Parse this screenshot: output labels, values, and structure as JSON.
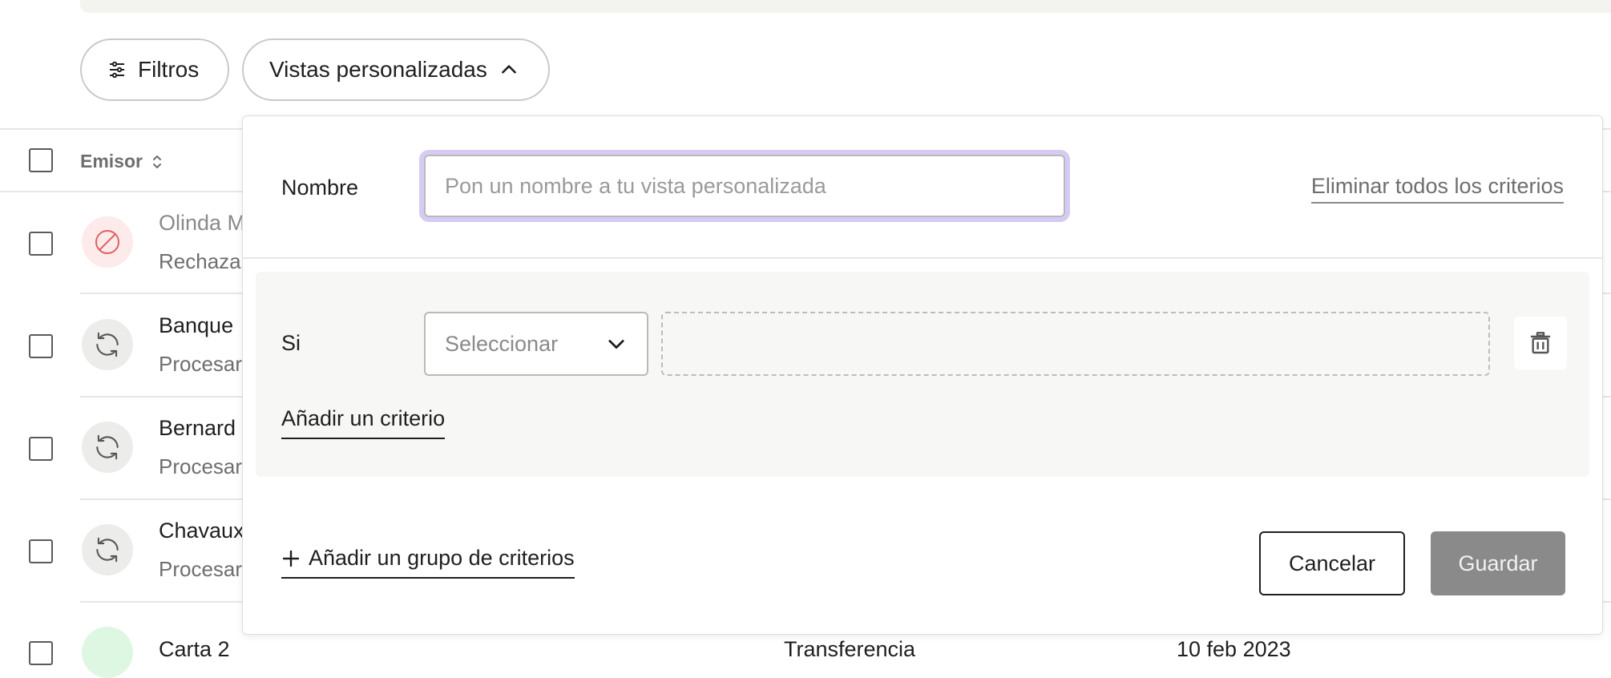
{
  "toolbar": {
    "filters_label": "Filtros",
    "views_label": "Vistas personalizadas"
  },
  "table": {
    "header_sender": "Emisor",
    "rows": [
      {
        "name": "Olinda M",
        "status": "Rechaza",
        "state": "rejected"
      },
      {
        "name": "Banque",
        "status": "Procesar",
        "state": "processing"
      },
      {
        "name": "Bernard",
        "status": "Procesar",
        "state": "processing"
      },
      {
        "name": "Chavaux",
        "status": "Procesar",
        "state": "processing"
      },
      {
        "name": "Carta 2",
        "status": "",
        "state": "ok"
      }
    ],
    "partial_type": "Transferencia",
    "partial_date": "10 feb 2023"
  },
  "panel": {
    "name_label": "Nombre",
    "name_value": "",
    "name_placeholder": "Pon un nombre a tu vista personalizada",
    "remove_all": "Eliminar todos los criterios",
    "if_label": "Si",
    "select_placeholder": "Seleccionar",
    "add_criterion": "Añadir un criterio",
    "add_group": "Añadir un grupo de criterios",
    "cancel": "Cancelar",
    "save": "Guardar"
  },
  "colors": {
    "focus_ring": "#d6cbf3",
    "save_disabled": "#8a8a8a",
    "rejected_bg": "#fdeaea",
    "rejected_icon": "#e06060",
    "processing_bg": "#ececea"
  }
}
